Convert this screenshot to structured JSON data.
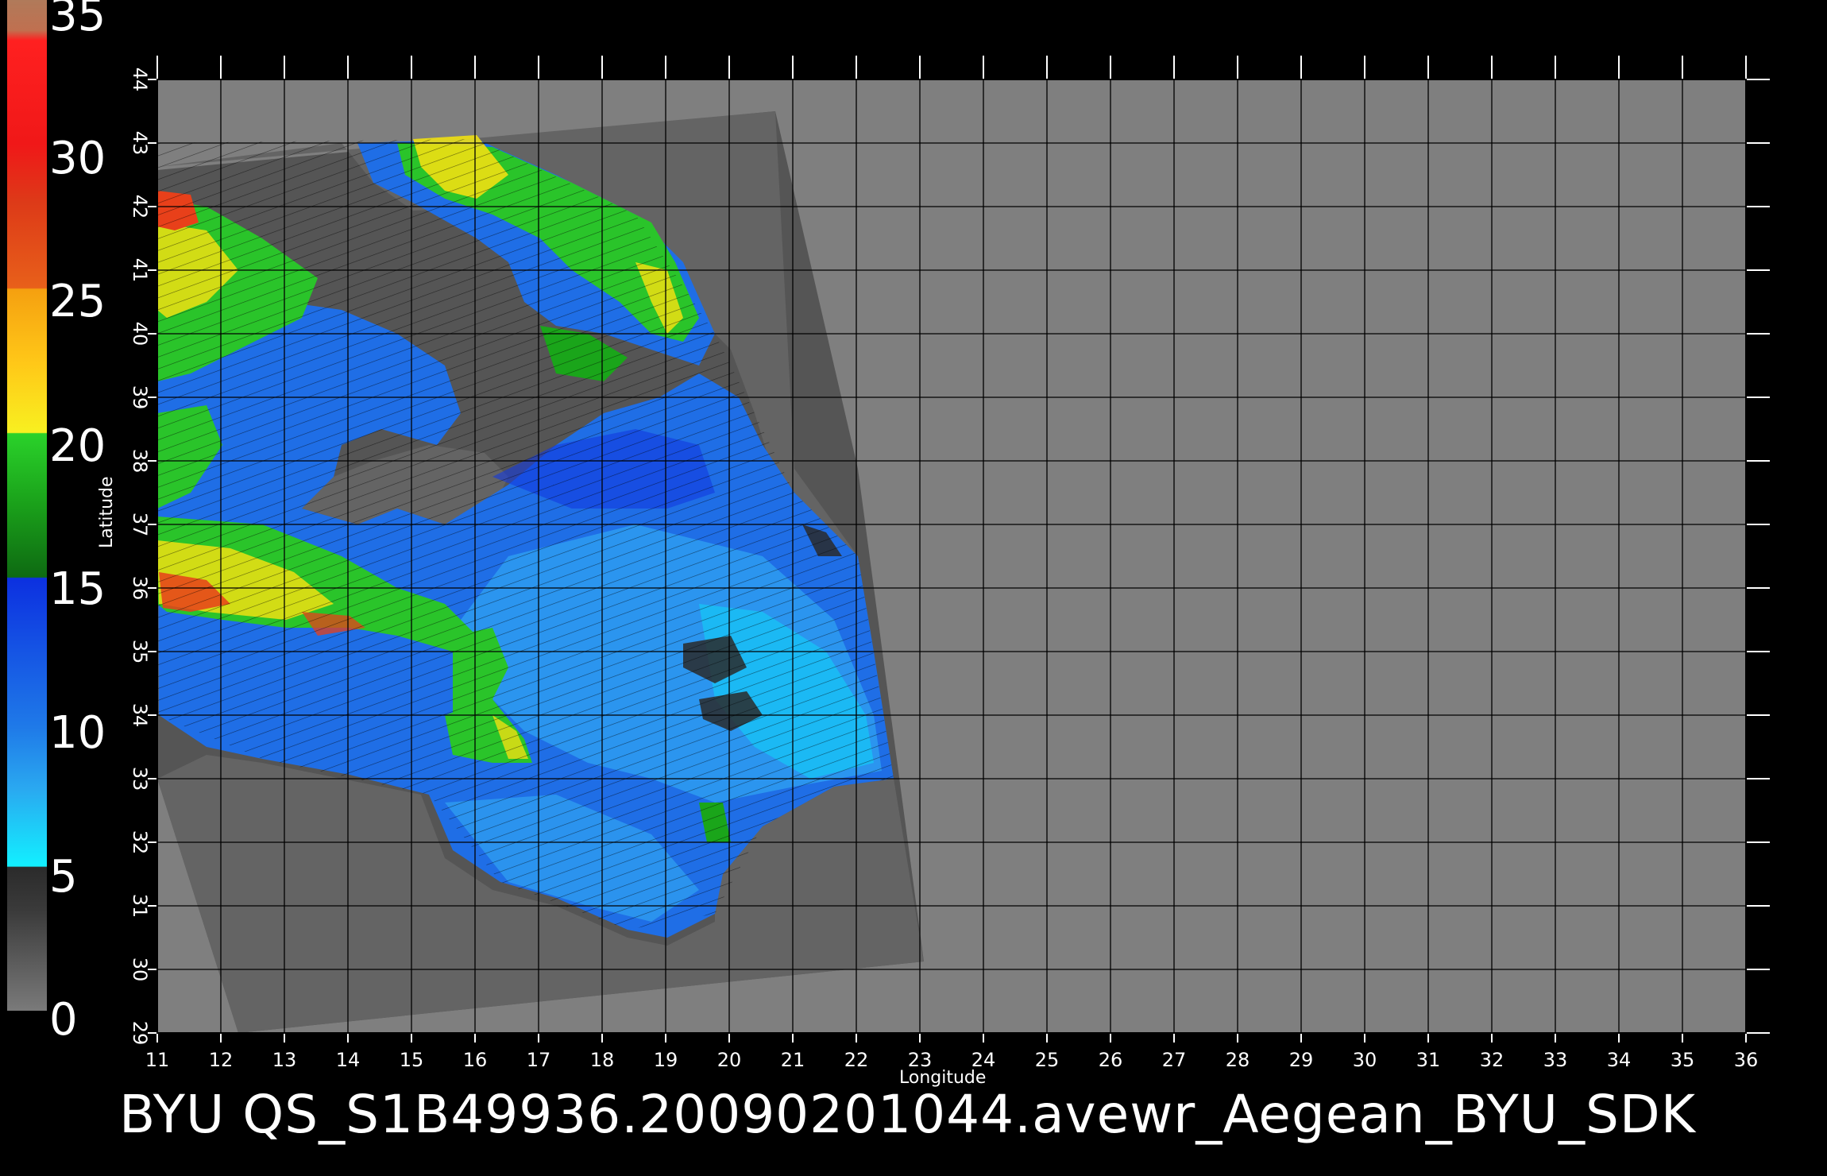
{
  "caption": "BYU  QS_S1B49936.20090201044.avewr_Aegean_BYU_SDK",
  "axes": {
    "xlabel": "Longitude",
    "ylabel": "Latitude",
    "lon_range": [
      11,
      36
    ],
    "lat_range": [
      29,
      44
    ],
    "lon_ticks": [
      "11",
      "12",
      "13",
      "14",
      "15",
      "16",
      "17",
      "18",
      "19",
      "20",
      "21",
      "22",
      "23",
      "24",
      "25",
      "26",
      "27",
      "28",
      "29",
      "30",
      "31",
      "32",
      "33",
      "34",
      "35",
      "36"
    ],
    "lat_ticks": [
      "29",
      "30",
      "31",
      "32",
      "33",
      "34",
      "35",
      "36",
      "37",
      "38",
      "39",
      "40",
      "41",
      "42",
      "43",
      "44"
    ]
  },
  "colorbar": {
    "labels": [
      "0",
      "5",
      "10",
      "15",
      "20",
      "25",
      "30",
      "35"
    ],
    "colors": [
      "#6e6e6e",
      "#0fe6f5",
      "#1e6df0",
      "#1aa51a",
      "#f0e012",
      "#f07a12",
      "#e61a1a",
      "#b5754f"
    ]
  },
  "colors": {
    "background": "#000000",
    "frame_gray": "#7f7f7f",
    "swath_gray": "#555555",
    "land_gray": "#5a5a5a",
    "grid": "#000000"
  }
}
